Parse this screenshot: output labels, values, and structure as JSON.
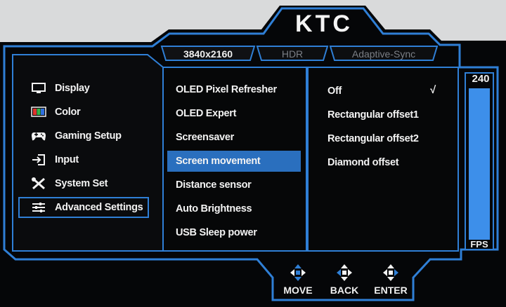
{
  "brand": {
    "name": "KTC"
  },
  "tabs": [
    {
      "label": "3840x2160",
      "active": true
    },
    {
      "label": "HDR",
      "active": false
    },
    {
      "label": "Adaptive-Sync",
      "active": false
    }
  ],
  "main_menu": [
    {
      "label": "Display",
      "icon": "monitor-icon"
    },
    {
      "label": "Color",
      "icon": "color-palette-icon"
    },
    {
      "label": "Gaming Setup",
      "icon": "gamepad-icon"
    },
    {
      "label": "Input",
      "icon": "input-arrow-icon"
    },
    {
      "label": "System Set",
      "icon": "wrench-screwdriver-icon"
    },
    {
      "label": "Advanced Settings",
      "icon": "sliders-icon",
      "selected": true
    }
  ],
  "sub_menu": [
    {
      "label": "OLED Pixel Refresher"
    },
    {
      "label": "OLED Expert"
    },
    {
      "label": "Screensaver"
    },
    {
      "label": "Screen movement",
      "highlighted": true
    },
    {
      "label": "Distance sensor"
    },
    {
      "label": "Auto Brightness"
    },
    {
      "label": "USB Sleep power"
    }
  ],
  "options": [
    {
      "label": "Off",
      "checked": true
    },
    {
      "label": "Rectangular offset1"
    },
    {
      "label": "Rectangular offset2"
    },
    {
      "label": "Diamond offset"
    }
  ],
  "check_mark": "√",
  "refresh_meter": {
    "value": "240",
    "unit": "FPS",
    "fill_fraction": 1.0
  },
  "nav_hints": [
    {
      "label": "MOVE",
      "icon": "dpad-move-icon"
    },
    {
      "label": "BACK",
      "icon": "dpad-back-icon"
    },
    {
      "label": "ENTER",
      "icon": "dpad-enter-icon"
    }
  ],
  "colors": {
    "background": "#000000",
    "frame": "#2f7fd6",
    "highlight": "#2a6fbe",
    "text": "#f2f2f2",
    "inactive_tab": "#7b7f86",
    "meter": "#3d8fea"
  }
}
